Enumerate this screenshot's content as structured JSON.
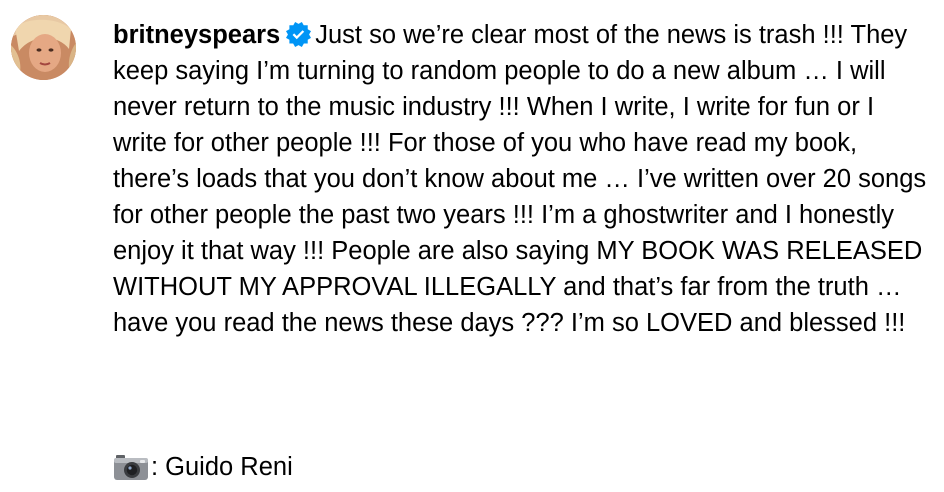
{
  "post": {
    "username": "britneyspears",
    "verified_badge_icon": "verified-badge-icon",
    "caption": "Just so we’re clear most of the news is trash !!! They keep saying I’m turning to random people to do a new album … I will never return to the music industry !!! When I write, I write for fun or I write for other people !!! For those of you who have read my book, there’s loads that you don’t know about me … I’ve written over 20 songs for other people the past two years !!! I’m a ghostwriter and I honestly enjoy it that way !!! People are also saying MY BOOK WAS RELEASED WITHOUT MY APPROVAL ILLEGALLY and that’s far from the truth … have you read the news these days ??? I’m so LOVED and blessed !!!",
    "photo_credit_icon": "camera-icon",
    "photo_credit": ": Guido Reni",
    "colors": {
      "text": "#000000",
      "verified_badge": "#0095f6"
    }
  }
}
